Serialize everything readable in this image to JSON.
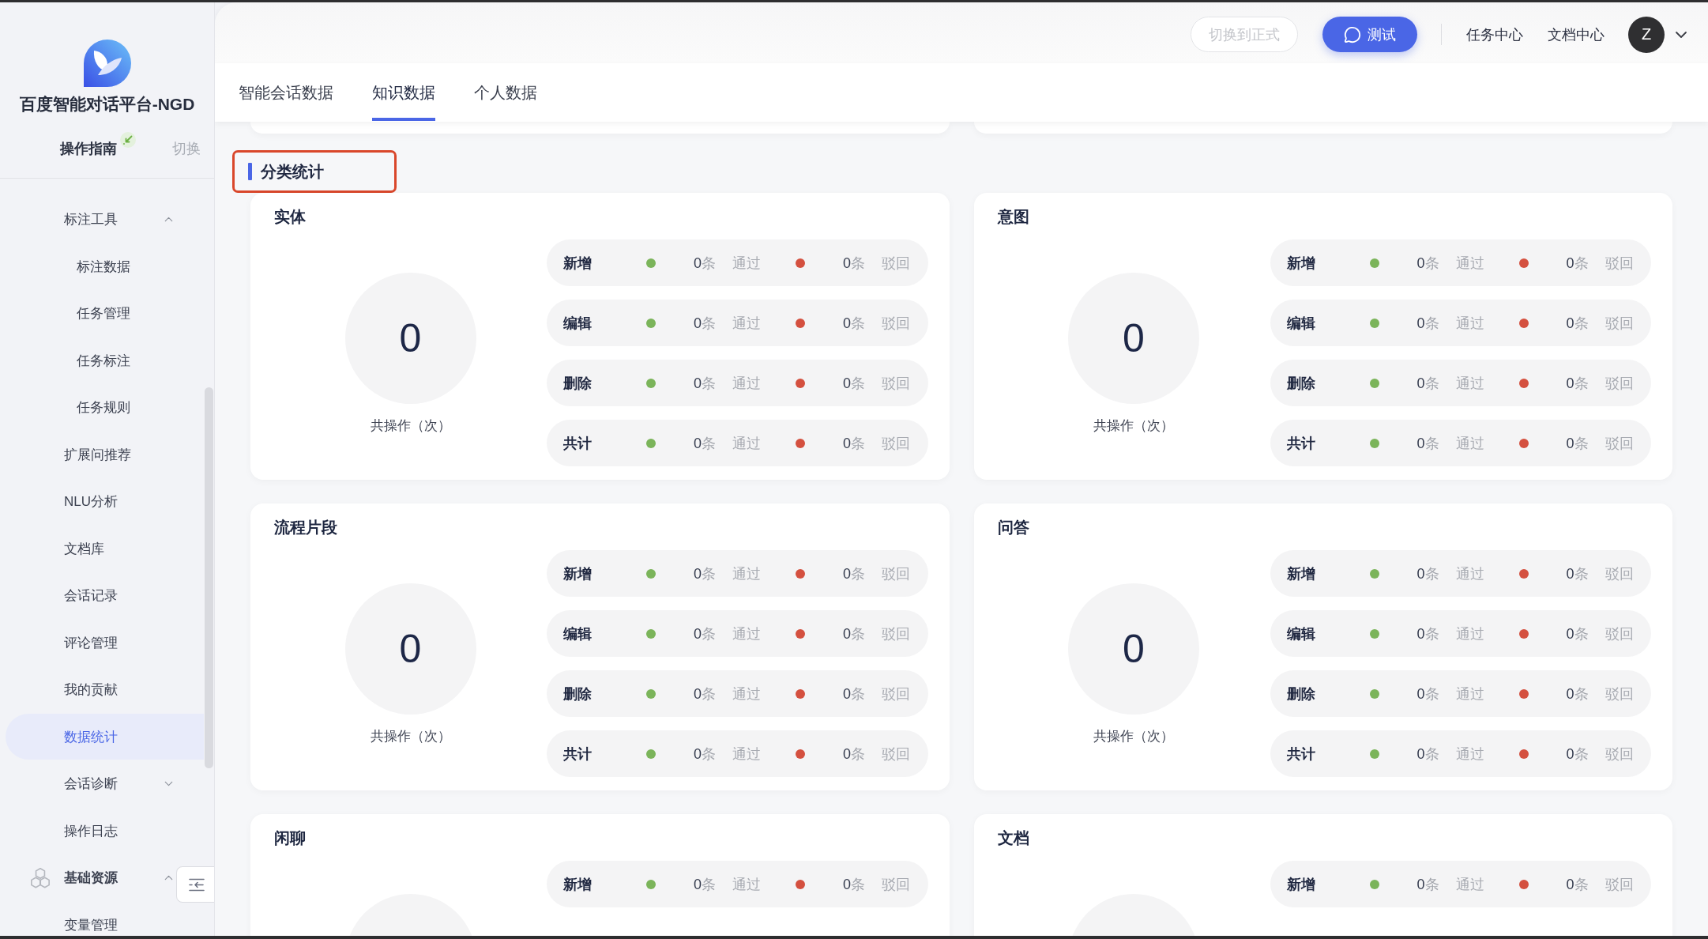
{
  "sidebar": {
    "app_name": "百度智能对话平台-NGD",
    "guide_link": "操作指南",
    "switch_link": "切换",
    "menu": [
      {
        "kind": "folder",
        "label": "标注工具",
        "selected": false,
        "expanded": true,
        "children": [
          {
            "kind": "item",
            "label": "标注数据",
            "selected": false
          },
          {
            "kind": "item",
            "label": "任务管理",
            "selected": false
          },
          {
            "kind": "item",
            "label": "任务标注",
            "selected": false
          },
          {
            "kind": "item",
            "label": "任务规则",
            "selected": false
          }
        ]
      },
      {
        "kind": "item",
        "label": "扩展问推荐",
        "selected": false
      },
      {
        "kind": "item",
        "label": "NLU分析",
        "selected": false
      },
      {
        "kind": "item",
        "label": "文档库",
        "selected": false
      },
      {
        "kind": "item",
        "label": "会话记录",
        "selected": false
      },
      {
        "kind": "item",
        "label": "评论管理",
        "selected": false
      },
      {
        "kind": "item",
        "label": "我的贡献",
        "selected": false
      },
      {
        "kind": "item",
        "label": "数据统计",
        "selected": true
      },
      {
        "kind": "folder",
        "label": "会话诊断",
        "selected": false,
        "expanded": false
      },
      {
        "kind": "item",
        "label": "操作日志",
        "selected": false
      },
      {
        "kind": "group",
        "label": "基础资源",
        "selected": false,
        "expanded": true,
        "children": [
          {
            "kind": "item",
            "label": "变量管理",
            "selected": false
          }
        ]
      }
    ]
  },
  "header": {
    "switch_button": {
      "label": "切换到正式",
      "disabled": true
    },
    "test_button": "测试",
    "links": [
      "任务中心",
      "文档中心"
    ],
    "avatar": "Z"
  },
  "tabs": [
    {
      "label": "智能会话数据",
      "selected": false
    },
    {
      "label": "知识数据",
      "selected": true
    },
    {
      "label": "个人数据",
      "selected": false
    }
  ],
  "section": {
    "title": "分类统计",
    "highlighted": true
  },
  "cards": [
    {
      "title": "实体",
      "total": "0",
      "total_label": "共操作（次）",
      "rows": [
        {
          "label": "新增",
          "results": [
            {
              "color": "#7bb45a",
              "count": "0",
              "unit": "条",
              "status": "通过"
            },
            {
              "color": "#d4503f",
              "count": "0",
              "unit": "条",
              "status": "驳回"
            }
          ]
        },
        {
          "label": "编辑",
          "results": [
            {
              "color": "#7bb45a",
              "count": "0",
              "unit": "条",
              "status": "通过"
            },
            {
              "color": "#d4503f",
              "count": "0",
              "unit": "条",
              "status": "驳回"
            }
          ]
        },
        {
          "label": "删除",
          "results": [
            {
              "color": "#7bb45a",
              "count": "0",
              "unit": "条",
              "status": "通过"
            },
            {
              "color": "#d4503f",
              "count": "0",
              "unit": "条",
              "status": "驳回"
            }
          ]
        },
        {
          "label": "共计",
          "results": [
            {
              "color": "#7bb45a",
              "count": "0",
              "unit": "条",
              "status": "通过"
            },
            {
              "color": "#d4503f",
              "count": "0",
              "unit": "条",
              "status": "驳回"
            }
          ]
        }
      ]
    },
    {
      "title": "意图",
      "total": "0",
      "total_label": "共操作（次）",
      "rows": [
        {
          "label": "新增",
          "results": [
            {
              "color": "#7bb45a",
              "count": "0",
              "unit": "条",
              "status": "通过"
            },
            {
              "color": "#d4503f",
              "count": "0",
              "unit": "条",
              "status": "驳回"
            }
          ]
        },
        {
          "label": "编辑",
          "results": [
            {
              "color": "#7bb45a",
              "count": "0",
              "unit": "条",
              "status": "通过"
            },
            {
              "color": "#d4503f",
              "count": "0",
              "unit": "条",
              "status": "驳回"
            }
          ]
        },
        {
          "label": "删除",
          "results": [
            {
              "color": "#7bb45a",
              "count": "0",
              "unit": "条",
              "status": "通过"
            },
            {
              "color": "#d4503f",
              "count": "0",
              "unit": "条",
              "status": "驳回"
            }
          ]
        },
        {
          "label": "共计",
          "results": [
            {
              "color": "#7bb45a",
              "count": "0",
              "unit": "条",
              "status": "通过"
            },
            {
              "color": "#d4503f",
              "count": "0",
              "unit": "条",
              "status": "驳回"
            }
          ]
        }
      ]
    },
    {
      "title": "流程片段",
      "total": "0",
      "total_label": "共操作（次）",
      "rows": [
        {
          "label": "新增",
          "results": [
            {
              "color": "#7bb45a",
              "count": "0",
              "unit": "条",
              "status": "通过"
            },
            {
              "color": "#d4503f",
              "count": "0",
              "unit": "条",
              "status": "驳回"
            }
          ]
        },
        {
          "label": "编辑",
          "results": [
            {
              "color": "#7bb45a",
              "count": "0",
              "unit": "条",
              "status": "通过"
            },
            {
              "color": "#d4503f",
              "count": "0",
              "unit": "条",
              "status": "驳回"
            }
          ]
        },
        {
          "label": "删除",
          "results": [
            {
              "color": "#7bb45a",
              "count": "0",
              "unit": "条",
              "status": "通过"
            },
            {
              "color": "#d4503f",
              "count": "0",
              "unit": "条",
              "status": "驳回"
            }
          ]
        },
        {
          "label": "共计",
          "results": [
            {
              "color": "#7bb45a",
              "count": "0",
              "unit": "条",
              "status": "通过"
            },
            {
              "color": "#d4503f",
              "count": "0",
              "unit": "条",
              "status": "驳回"
            }
          ]
        }
      ]
    },
    {
      "title": "问答",
      "total": "0",
      "total_label": "共操作（次）",
      "rows": [
        {
          "label": "新增",
          "results": [
            {
              "color": "#7bb45a",
              "count": "0",
              "unit": "条",
              "status": "通过"
            },
            {
              "color": "#d4503f",
              "count": "0",
              "unit": "条",
              "status": "驳回"
            }
          ]
        },
        {
          "label": "编辑",
          "results": [
            {
              "color": "#7bb45a",
              "count": "0",
              "unit": "条",
              "status": "通过"
            },
            {
              "color": "#d4503f",
              "count": "0",
              "unit": "条",
              "status": "驳回"
            }
          ]
        },
        {
          "label": "删除",
          "results": [
            {
              "color": "#7bb45a",
              "count": "0",
              "unit": "条",
              "status": "通过"
            },
            {
              "color": "#d4503f",
              "count": "0",
              "unit": "条",
              "status": "驳回"
            }
          ]
        },
        {
          "label": "共计",
          "results": [
            {
              "color": "#7bb45a",
              "count": "0",
              "unit": "条",
              "status": "通过"
            },
            {
              "color": "#d4503f",
              "count": "0",
              "unit": "条",
              "status": "驳回"
            }
          ]
        }
      ]
    },
    {
      "title": "闲聊",
      "rows": [
        {
          "label": "新增",
          "results": [
            {
              "color": "#7bb45a",
              "count": "0",
              "unit": "条",
              "status": "通过"
            },
            {
              "color": "#d4503f",
              "count": "0",
              "unit": "条",
              "status": "驳回"
            }
          ]
        }
      ]
    },
    {
      "title": "文档",
      "rows": [
        {
          "label": "新增",
          "results": [
            {
              "color": "#7bb45a",
              "count": "0",
              "unit": "条",
              "status": "通过"
            },
            {
              "color": "#d4503f",
              "count": "0",
              "unit": "条",
              "status": "驳回"
            }
          ]
        }
      ]
    }
  ]
}
